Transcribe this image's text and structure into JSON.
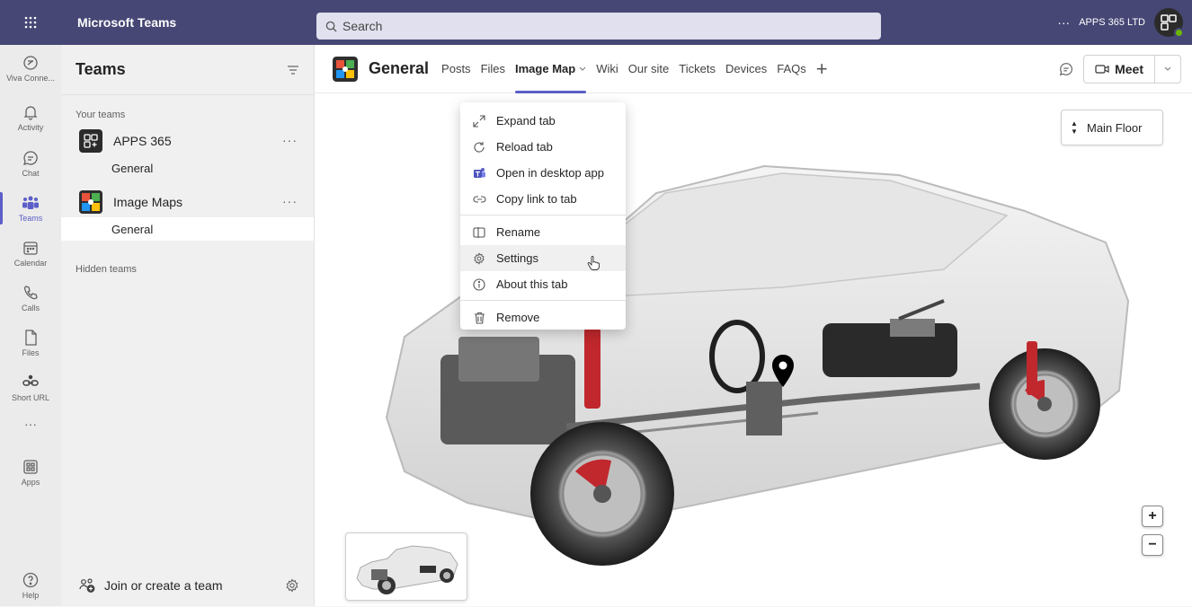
{
  "app": {
    "title": "Microsoft Teams"
  },
  "search": {
    "placeholder": "Search"
  },
  "header": {
    "more": "···",
    "org": "APPS 365 LTD"
  },
  "rail": [
    {
      "label": "Viva Conne...",
      "icon": "viva-connections-icon"
    },
    {
      "label": "Activity",
      "icon": "bell-icon"
    },
    {
      "label": "Chat",
      "icon": "chat-icon"
    },
    {
      "label": "Teams",
      "icon": "teams-icon",
      "active": true
    },
    {
      "label": "Calendar",
      "icon": "calendar-icon"
    },
    {
      "label": "Calls",
      "icon": "phone-icon"
    },
    {
      "label": "Files",
      "icon": "file-icon"
    },
    {
      "label": "Short URL",
      "icon": "short-url-icon"
    },
    {
      "label": "···",
      "icon": "more-icon"
    },
    {
      "label": "Apps",
      "icon": "apps-icon"
    },
    {
      "label": "Help",
      "icon": "help-icon"
    }
  ],
  "teams_panel": {
    "title": "Teams",
    "your_teams_label": "Your teams",
    "teams": [
      {
        "name": "APPS 365",
        "channels": [
          "General"
        ]
      },
      {
        "name": "Image Maps",
        "channels": [
          "General"
        ]
      }
    ],
    "hidden_label": "Hidden teams",
    "join_label": "Join or create a team"
  },
  "channel": {
    "name": "General",
    "tabs": [
      "Posts",
      "Files",
      "Image Map",
      "Wiki",
      "Our site",
      "Tickets",
      "Devices",
      "FAQs"
    ],
    "active_tab": "Image Map",
    "meet_label": "Meet"
  },
  "context_menu": {
    "items": [
      {
        "label": "Expand tab",
        "icon": "expand-icon"
      },
      {
        "label": "Reload tab",
        "icon": "reload-icon"
      },
      {
        "label": "Open in desktop app",
        "icon": "teams-app-icon"
      },
      {
        "label": "Copy link to tab",
        "icon": "link-icon"
      },
      {
        "label": "Rename",
        "icon": "rename-icon"
      },
      {
        "label": "Settings",
        "icon": "settings-icon"
      },
      {
        "label": "About this tab",
        "icon": "info-icon"
      },
      {
        "label": "Remove",
        "icon": "trash-icon"
      }
    ]
  },
  "map": {
    "floor": "Main Floor",
    "zoom_in": "+",
    "zoom_out": "−"
  },
  "colors": {
    "topbar": "#464775",
    "accent": "#5b5fc7",
    "brake": "#c0282d"
  }
}
